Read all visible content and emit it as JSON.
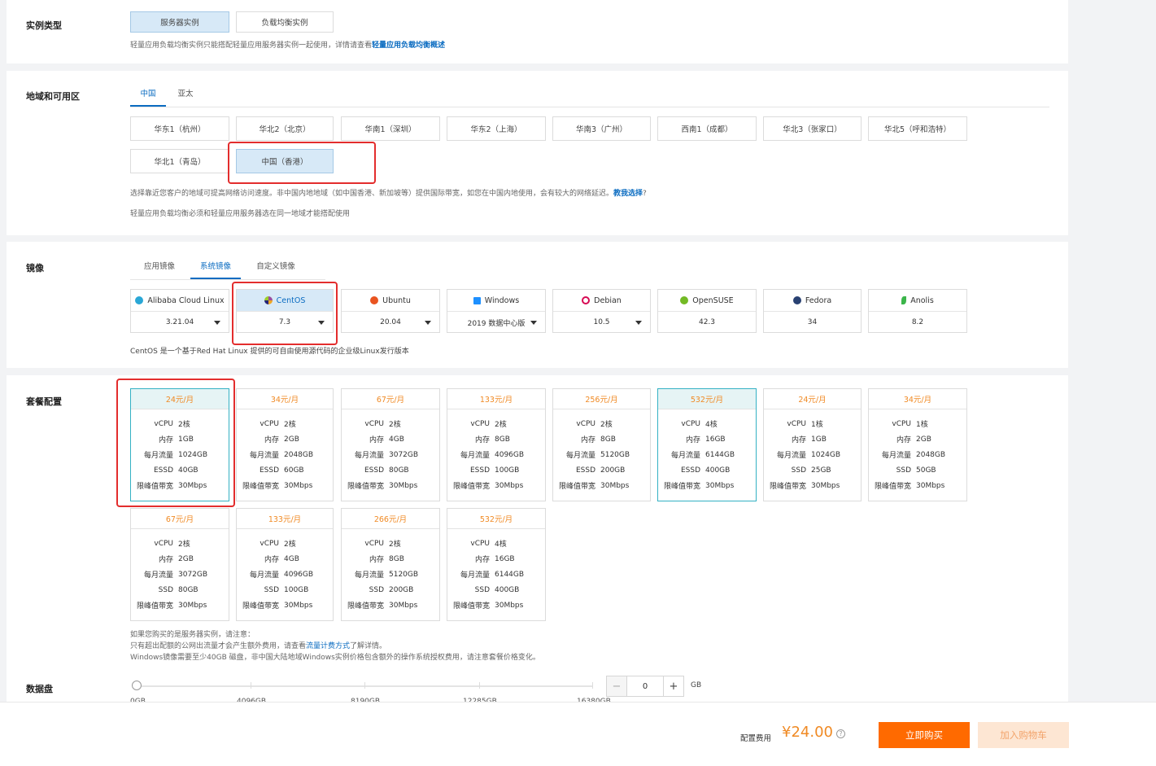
{
  "instance_type": {
    "title": "实例类型",
    "options": [
      "服务器实例",
      "负载均衡实例"
    ],
    "selected": 0,
    "hint_prefix": "轻量应用负载均衡实例只能搭配轻量应用服务器实例一起使用，详情请查看",
    "hint_link": "轻量应用负载均衡概述"
  },
  "region": {
    "title": "地域和可用区",
    "tabs": [
      "中国",
      "亚太"
    ],
    "active_tab": 0,
    "options": [
      "华东1（杭州）",
      "华北2（北京）",
      "华南1（深圳）",
      "华东2（上海）",
      "华南3（广州）",
      "西南1（成都）",
      "华北3（张家口）",
      "华北5（呼和浩特）",
      "华北1（青岛）",
      "中国（香港）"
    ],
    "selected": 9,
    "hint1_prefix": "选择靠近您客户的地域可提高网络访问速度。非中国内地地域（如中国香港、新加坡等）提供国际带宽，如您在中国内地使用，会有较大的网络延迟。",
    "hint1_link": "教我选择",
    "hint1_suffix": "?",
    "hint2": "轻量应用负载均衡必须和轻量应用服务器选在同一地域才能搭配使用"
  },
  "image": {
    "title": "镜像",
    "tabs": [
      "应用镜像",
      "系统镜像",
      "自定义镜像"
    ],
    "active_tab": 1,
    "items": [
      {
        "name": "Alibaba Cloud Linux",
        "version": "3.21.04",
        "dropdown": true,
        "icon": "alibaba-cloud-linux-icon",
        "color": "#2aa7d6"
      },
      {
        "name": "CentOS",
        "version": "7.3",
        "dropdown": true,
        "icon": "centos-icon",
        "color": "#9b4d9c"
      },
      {
        "name": "Ubuntu",
        "version": "20.04",
        "dropdown": true,
        "icon": "ubuntu-icon",
        "color": "#e95420"
      },
      {
        "name": "Windows",
        "version": "2019 数据中心版",
        "dropdown": true,
        "icon": "windows-icon",
        "color": "#1e90ff"
      },
      {
        "name": "Debian",
        "version": "10.5",
        "dropdown": true,
        "icon": "debian-icon",
        "color": "#d70a53"
      },
      {
        "name": "OpenSUSE",
        "version": "42.3",
        "dropdown": false,
        "icon": "opensuse-icon",
        "color": "#73ba25"
      },
      {
        "name": "Fedora",
        "version": "34",
        "dropdown": false,
        "icon": "fedora-icon",
        "color": "#294172"
      },
      {
        "name": "Anolis",
        "version": "8.2",
        "dropdown": false,
        "icon": "anolis-icon",
        "color": "#3bb54a"
      }
    ],
    "selected": 1,
    "description": "CentOS 是一个基于Red Hat Linux 提供的可自由使用源代码的企业级Linux发行版本"
  },
  "plans": {
    "title": "套餐配置",
    "labels": {
      "cpu": "vCPU",
      "mem": "内存",
      "traffic": "每月流量",
      "bw": "限峰值带宽"
    },
    "items": [
      {
        "price": "24元/月",
        "cpu": "2核",
        "mem": "1GB",
        "traffic": "1024GB",
        "disk_type": "ESSD",
        "disk": "40GB",
        "bw": "30Mbps",
        "selected": true
      },
      {
        "price": "34元/月",
        "cpu": "2核",
        "mem": "2GB",
        "traffic": "2048GB",
        "disk_type": "ESSD",
        "disk": "60GB",
        "bw": "30Mbps",
        "selected": false
      },
      {
        "price": "67元/月",
        "cpu": "2核",
        "mem": "4GB",
        "traffic": "3072GB",
        "disk_type": "ESSD",
        "disk": "80GB",
        "bw": "30Mbps",
        "selected": false
      },
      {
        "price": "133元/月",
        "cpu": "2核",
        "mem": "8GB",
        "traffic": "4096GB",
        "disk_type": "ESSD",
        "disk": "100GB",
        "bw": "30Mbps",
        "selected": false
      },
      {
        "price": "256元/月",
        "cpu": "2核",
        "mem": "8GB",
        "traffic": "5120GB",
        "disk_type": "ESSD",
        "disk": "200GB",
        "bw": "30Mbps",
        "selected": false
      },
      {
        "price": "532元/月",
        "cpu": "4核",
        "mem": "16GB",
        "traffic": "6144GB",
        "disk_type": "ESSD",
        "disk": "400GB",
        "bw": "30Mbps",
        "selected": true
      },
      {
        "price": "24元/月",
        "cpu": "1核",
        "mem": "1GB",
        "traffic": "1024GB",
        "disk_type": "SSD",
        "disk": "25GB",
        "bw": "30Mbps",
        "selected": false
      },
      {
        "price": "34元/月",
        "cpu": "1核",
        "mem": "2GB",
        "traffic": "2048GB",
        "disk_type": "SSD",
        "disk": "50GB",
        "bw": "30Mbps",
        "selected": false
      },
      {
        "price": "67元/月",
        "cpu": "2核",
        "mem": "2GB",
        "traffic": "3072GB",
        "disk_type": "SSD",
        "disk": "80GB",
        "bw": "30Mbps",
        "selected": false
      },
      {
        "price": "133元/月",
        "cpu": "2核",
        "mem": "4GB",
        "traffic": "4096GB",
        "disk_type": "SSD",
        "disk": "100GB",
        "bw": "30Mbps",
        "selected": false
      },
      {
        "price": "266元/月",
        "cpu": "2核",
        "mem": "8GB",
        "traffic": "5120GB",
        "disk_type": "SSD",
        "disk": "200GB",
        "bw": "30Mbps",
        "selected": false
      },
      {
        "price": "532元/月",
        "cpu": "4核",
        "mem": "16GB",
        "traffic": "6144GB",
        "disk_type": "SSD",
        "disk": "400GB",
        "bw": "30Mbps",
        "selected": false
      }
    ],
    "note1": "如果您购买的是服务器实例，请注意：",
    "note2_prefix": "只有超出配额的公网出流量才会产生额外费用，请查看",
    "note2_link": "流量计费方式",
    "note2_suffix": "了解详情。",
    "note3": "Windows镜像需要至少40GB 磁盘，非中国大陆地域Windows实例价格包含额外的操作系统授权费用，请注意套餐价格变化。"
  },
  "data_disk": {
    "title": "数据盘",
    "ticks": [
      "0GB",
      "4096GB",
      "8190GB",
      "12285GB",
      "16380GB"
    ],
    "value": "0",
    "unit": "GB",
    "minus": "−",
    "plus": "+"
  },
  "footer": {
    "fee_label": "配置费用",
    "price": "¥24.00",
    "help": "?",
    "buy": "立即购买",
    "cart": "加入购物车"
  },
  "colors": {
    "accent": "#0b6cc1",
    "price": "#f08a24",
    "buy": "#ff6a00",
    "highlight": "#e32d2d"
  }
}
